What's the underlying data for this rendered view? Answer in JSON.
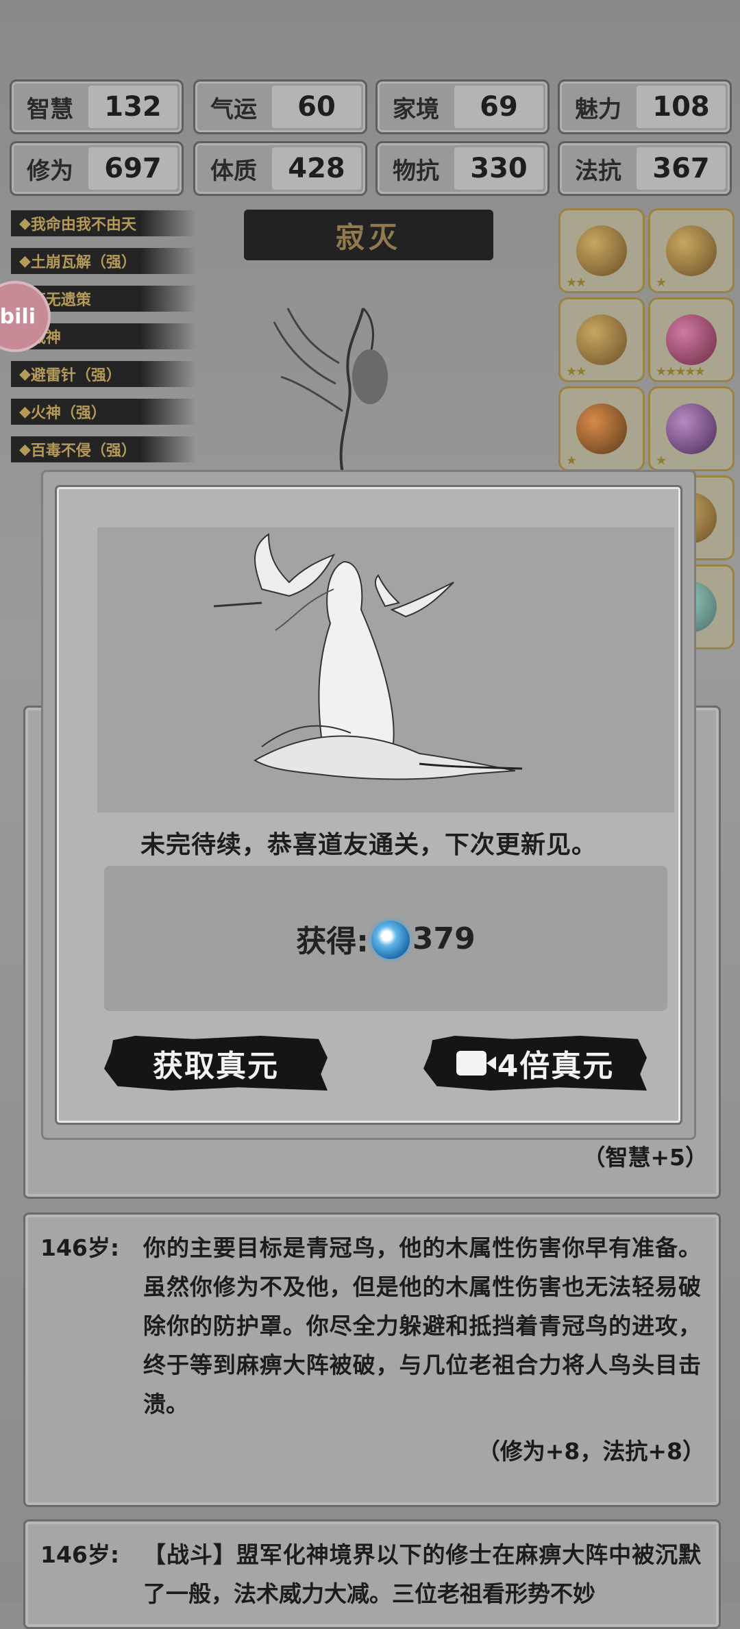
{
  "stats": [
    {
      "key": "智慧",
      "value": "132"
    },
    {
      "key": "气运",
      "value": "60"
    },
    {
      "key": "家境",
      "value": "69"
    },
    {
      "key": "魅力",
      "value": "108"
    },
    {
      "key": "修为",
      "value": "697"
    },
    {
      "key": "体质",
      "value": "428"
    },
    {
      "key": "物抗",
      "value": "330"
    },
    {
      "key": "法抗",
      "value": "367"
    }
  ],
  "traits": [
    "我命由我不由天",
    "土崩瓦解（强）",
    "算无遗策",
    "战神",
    "避雷针（强）",
    "火神（强）",
    "百毒不侵（强）"
  ],
  "stage_title": "寂灭",
  "badge": "bili",
  "log": [
    {
      "age": "146岁:",
      "text": "你的主要目标是青冠鸟，他的木属性伤害你早有准备。虽然你修为不及他，但是他的木属性伤害也无法轻易破除你的防护罩。你尽全力躲避和抵挡着青冠鸟的进攻，终于等到麻痹大阵被破，与几位老祖合力将人鸟头目击溃。",
      "reward": "（修为+8，法抗+8）"
    },
    {
      "age": "146岁:",
      "text": "【战斗】盟军化神境界以下的修士在麻痹大阵中被沉默了一般，法术威力大减。三位老祖看形势不妙"
    }
  ],
  "hidden_reward": "（智慧+5）",
  "modal": {
    "message": "未完待续，恭喜道友通关，下次更新见。",
    "reward_label": "获得:",
    "reward_value": "379",
    "btn_claim": "获取真元",
    "btn_video": "4倍真元"
  },
  "colors": {
    "accent_gold": "#9a8240",
    "orb_blue": "#1f6fb0"
  }
}
